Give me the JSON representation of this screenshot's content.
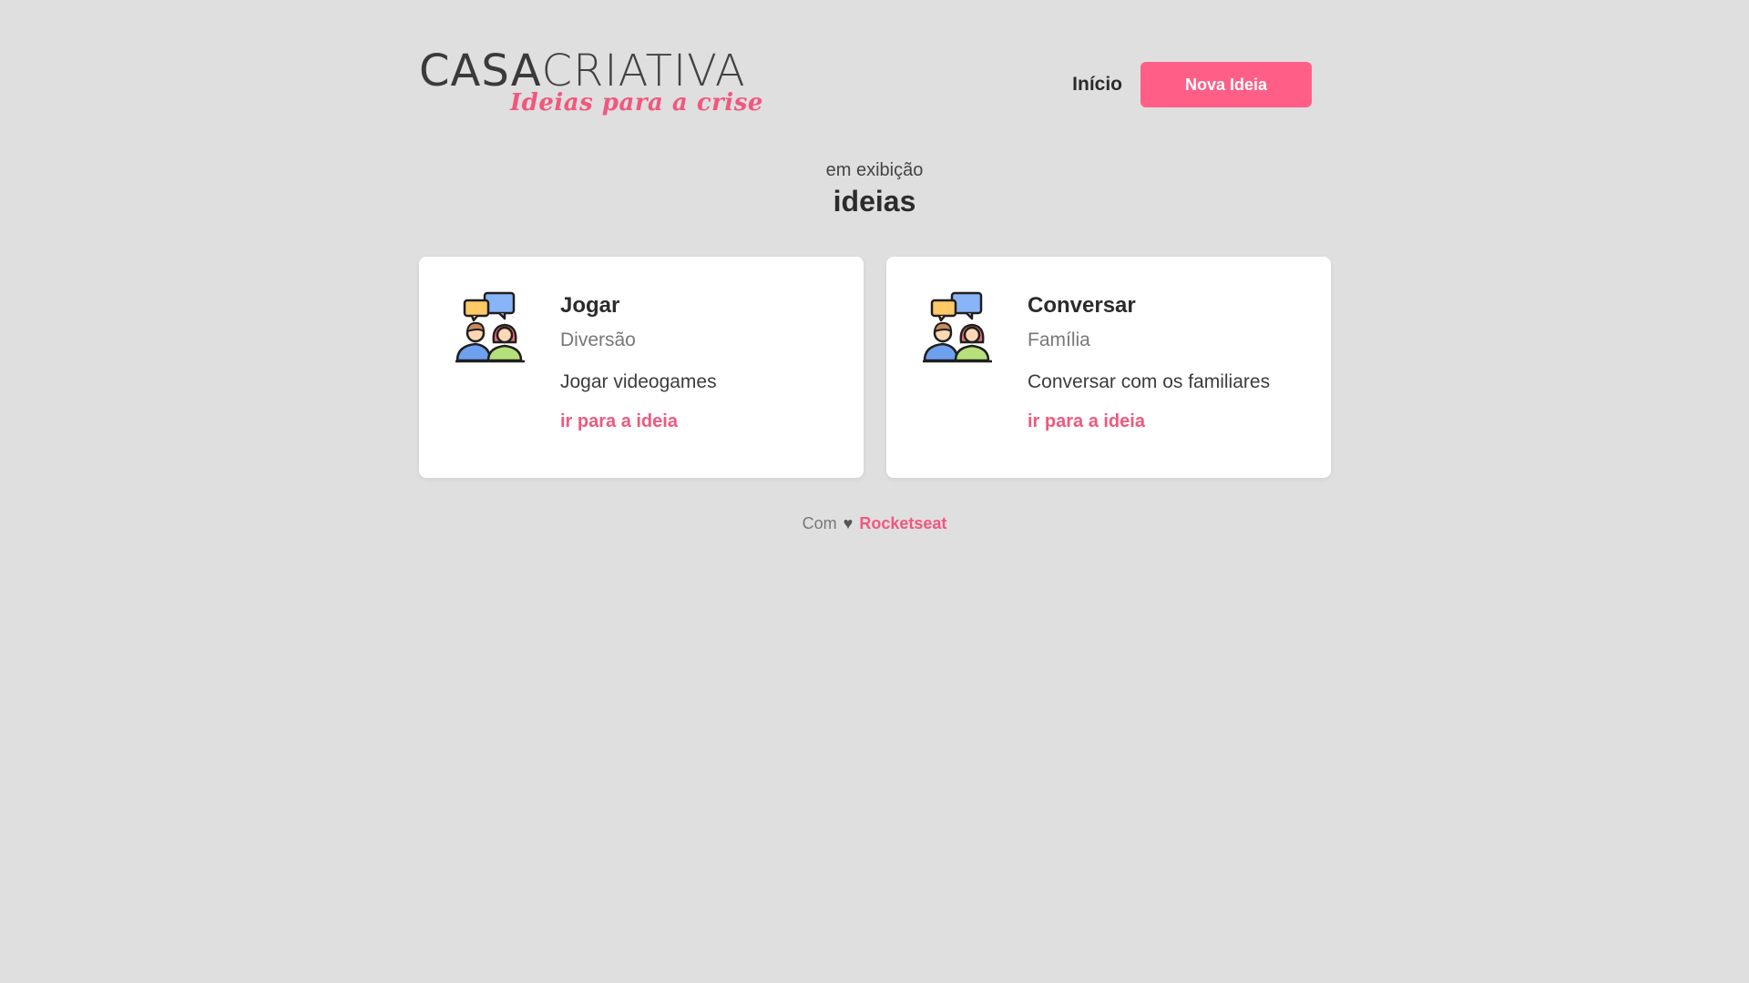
{
  "header": {
    "logo": {
      "main_bold": "CASA",
      "main_light": "CRIATIVA",
      "tagline": "Ideias para a crise"
    },
    "nav": {
      "home_label": "Início",
      "new_idea_label": "Nova Ideia"
    }
  },
  "section": {
    "subtitle": "em exibição",
    "title": "ideias"
  },
  "cards": [
    {
      "icon": "people-chat-icon",
      "title": "Jogar",
      "category": "Diversão",
      "description": "Jogar videogames",
      "link_label": "ir para a ideia"
    },
    {
      "icon": "people-chat-icon",
      "title": "Conversar",
      "category": "Família",
      "description": "Conversar com os familiares",
      "link_label": "ir para a ideia"
    }
  ],
  "footer": {
    "prefix": "Com",
    "heart": "♥",
    "brand": "Rocketseat"
  },
  "colors": {
    "accent": "#ff5f87",
    "background": "#dfdfdf",
    "card": "#ffffff"
  }
}
